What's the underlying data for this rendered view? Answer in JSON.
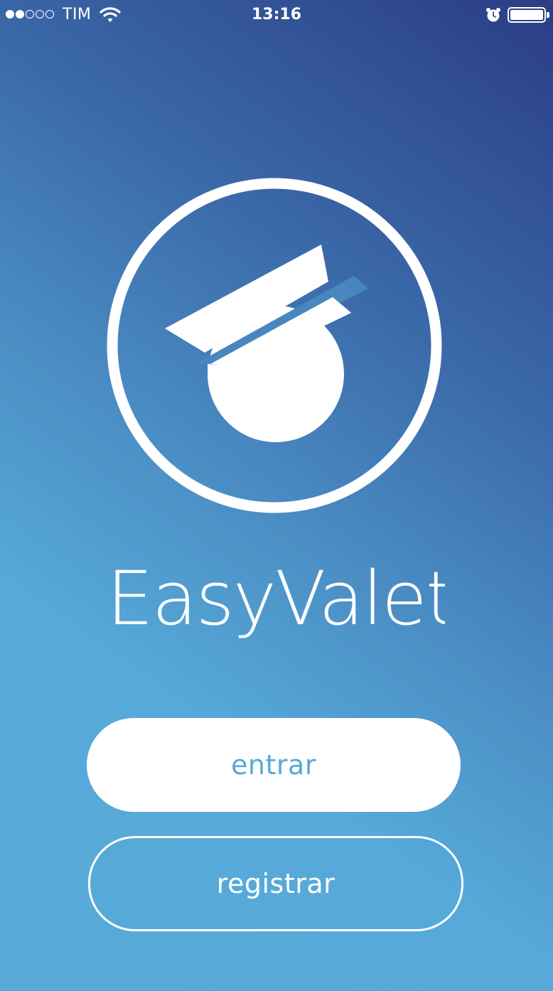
{
  "status_bar": {
    "carrier": "TIM",
    "time": "13:16",
    "signal_bars_filled": 2,
    "signal_bars_total": 5,
    "icons": [
      "wifi-icon",
      "alarm-icon",
      "battery-icon"
    ]
  },
  "app": {
    "name": "EasyValet",
    "logo_icon": "valet-cap-icon"
  },
  "actions": {
    "login_label": "entrar",
    "register_label": "registrar"
  },
  "colors": {
    "gradient_top": "#2b3d84",
    "gradient_bottom": "#58aad8",
    "accent": "#57a9d9",
    "white": "#ffffff"
  }
}
